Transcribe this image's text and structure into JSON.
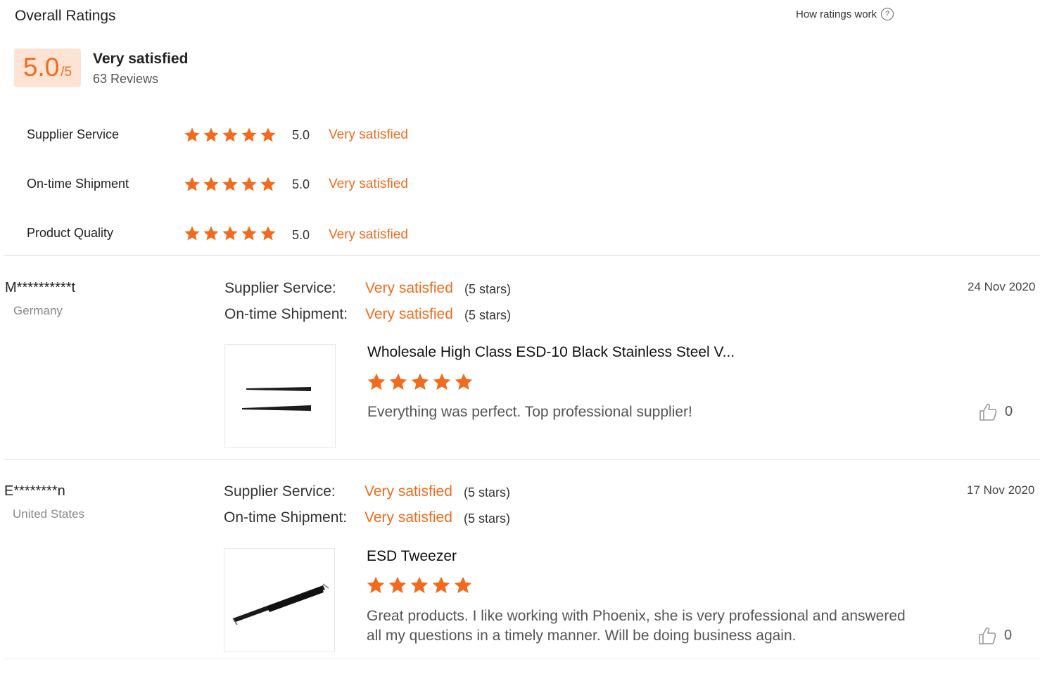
{
  "header": {
    "title": "Overall Ratings",
    "how_ratings": "How ratings work",
    "help_glyph": "?"
  },
  "overall": {
    "score": "5.0",
    "denominator": "/5",
    "label": "Very satisfied",
    "reviews": "63 Reviews",
    "stars": 5
  },
  "criteria": [
    {
      "label": "Supplier Service",
      "score": "5.0",
      "verdict": "Very satisfied",
      "stars": 5
    },
    {
      "label": "On-time Shipment",
      "score": "5.0",
      "verdict": "Very satisfied",
      "stars": 5
    },
    {
      "label": "Product Quality",
      "score": "5.0",
      "verdict": "Very satisfied",
      "stars": 5
    }
  ],
  "reviews": [
    {
      "reviewer": "M**********t",
      "country": "Germany",
      "date": "24 Nov 2020",
      "supplier_label": "Supplier Service:",
      "supplier_verdict": "Very satisfied",
      "supplier_stars": "(5 stars)",
      "shipment_label": "On-time Shipment:",
      "shipment_verdict": "Very satisfied",
      "shipment_stars": "(5 stars)",
      "product_title": "Wholesale High Class ESD-10 Black Stainless Steel V...",
      "rating": 5,
      "text_line1": "Everything was perfect. Top professional supplier!",
      "text_line2": "",
      "likes": "0",
      "thumb_icon": "tweezers-pair-image"
    },
    {
      "reviewer": "E********n",
      "country": "United States",
      "date": "17 Nov 2020",
      "supplier_label": "Supplier Service:",
      "supplier_verdict": "Very satisfied",
      "supplier_stars": "(5 stars)",
      "shipment_label": "On-time Shipment:",
      "shipment_verdict": "Very satisfied",
      "shipment_stars": "(5 stars)",
      "product_title": "ESD Tweezer",
      "rating": 5,
      "text_line1": "Great products. I like working with Phoenix, she is very professional and answered",
      "text_line2": "all my questions in a timely manner. Will be doing business again.",
      "likes": "0",
      "thumb_icon": "tweezer-diagonal-image"
    }
  ],
  "colors": {
    "accent": "#f26b1d",
    "score_bg": "#fde3d3",
    "divider": "#e2e2e2"
  }
}
